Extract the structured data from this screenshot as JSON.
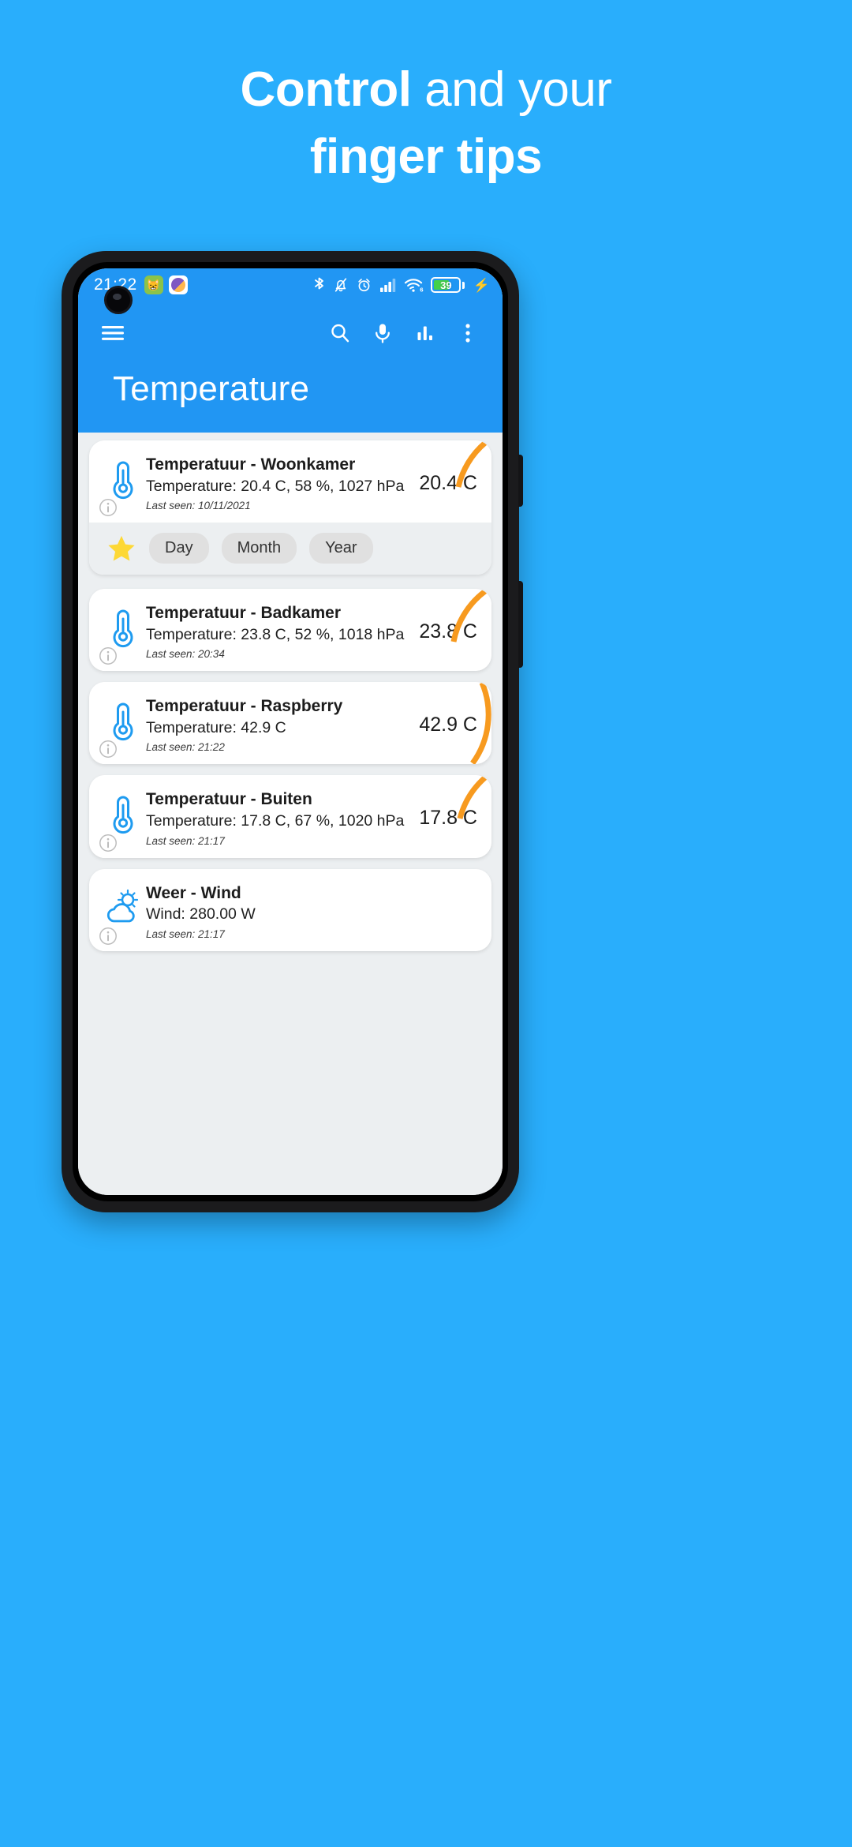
{
  "promo": {
    "line1_bold": "Control",
    "line1_rest": " and your",
    "line2": "finger tips",
    "background_color": "#29aefc",
    "text_color": "#ffffff"
  },
  "phone": {
    "status_bar": {
      "time": "21:22",
      "icons": [
        "cat-app-icon",
        "gallery-app-icon",
        "bluetooth-icon",
        "mute-bell-icon",
        "alarm-clock-icon",
        "signal-bars-icon",
        "wifi-6-icon",
        "battery-icon",
        "charging-bolt-icon"
      ],
      "battery_percent": "39",
      "wifi_label": "6",
      "background_color": "#2196f3"
    },
    "app_bar": {
      "menu_icon": "hamburger-menu-icon",
      "actions": [
        "search-icon",
        "microphone-icon",
        "bar-chart-icon",
        "overflow-menu-icon"
      ],
      "title": "Temperature",
      "accent_color": "#2196f3"
    },
    "chips": {
      "star_icon": "star-icon",
      "star_color": "#fdd835",
      "options": [
        "Day",
        "Month",
        "Year"
      ]
    },
    "cards": [
      {
        "icon": "thermometer-icon",
        "title": "Temperatuur - Woonkamer",
        "subtitle": "Temperature: 20.4 C, 58 %, 1027 hPa",
        "last_seen": "Last seen: 10/11/2021",
        "value": "20.4 C",
        "arc_extent": 0.28,
        "arc_color": "#f79a1f",
        "has_chips": true,
        "has_info": true
      },
      {
        "icon": "thermometer-icon",
        "title": "Temperatuur - Badkamer",
        "subtitle": "Temperature: 23.8 C, 52 %, 1018 hPa",
        "last_seen": "Last seen: 20:34",
        "value": "23.8 C",
        "arc_extent": 0.34,
        "arc_color": "#f79a1f",
        "has_chips": false,
        "has_info": true
      },
      {
        "icon": "thermometer-icon",
        "title": "Temperatuur - Raspberry",
        "subtitle": "Temperature: 42.9 C",
        "last_seen": "Last seen: 21:22",
        "value": "42.9 C",
        "arc_extent": 0.62,
        "arc_color": "#f79a1f",
        "has_chips": false,
        "has_info": true
      },
      {
        "icon": "thermometer-icon",
        "title": "Temperatuur - Buiten",
        "subtitle": "Temperature: 17.8 C, 67 %, 1020 hPa",
        "last_seen": "Last seen: 21:17",
        "value": "17.8 C",
        "arc_extent": 0.26,
        "arc_color": "#f79a1f",
        "has_chips": false,
        "has_info": true
      },
      {
        "icon": "cloud-sun-icon",
        "title": "Weer - Wind",
        "subtitle": "Wind: 280.00 W",
        "last_seen": "Last seen: 21:17",
        "value": "",
        "arc_extent": 0,
        "arc_color": "#f79a1f",
        "has_chips": false,
        "has_info": true
      }
    ]
  }
}
